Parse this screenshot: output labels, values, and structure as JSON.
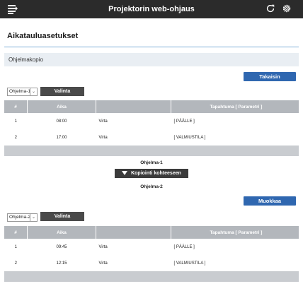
{
  "header": {
    "title": "Projektorin web-ohjaus",
    "icons": [
      "menu-icon",
      "refresh-icon",
      "gear-icon"
    ]
  },
  "page": {
    "title": "Aikatauluasetukset",
    "section": "Ohjelmakopio"
  },
  "top": {
    "back_label": "Takaisin",
    "program_select": "Ohjelma-1",
    "select_label": "Valinta"
  },
  "table": {
    "headers": [
      "#",
      "Aika",
      "",
      "Tapahtuma [ Parametri ]"
    ]
  },
  "top_rows": [
    {
      "num": "1",
      "time": "08:00",
      "name": "Virta",
      "param": "[ PÄÄLLE ]"
    },
    {
      "num": "2",
      "time": "17:00",
      "name": "Virta",
      "param": "[ VALMIUSTILA ]"
    }
  ],
  "copy": {
    "from": "Ohjelma-1",
    "button_label": "Kopiointi kohteeseen",
    "to": "Ohjelma-2"
  },
  "bottom": {
    "edit_label": "Muokkaa",
    "program_select": "Ohjelma-2",
    "select_label": "Valinta"
  },
  "bottom_rows": [
    {
      "num": "1",
      "time": "09:45",
      "name": "Virta",
      "param": "[ PÄÄLLE ]"
    },
    {
      "num": "2",
      "time": "12:15",
      "name": "Virta",
      "param": "[ VALMIUSTILA ]"
    }
  ],
  "colors": {
    "topbar": "#2b2b2b",
    "accent_button": "#2f67b0",
    "table_header": "#b3b7bc"
  }
}
